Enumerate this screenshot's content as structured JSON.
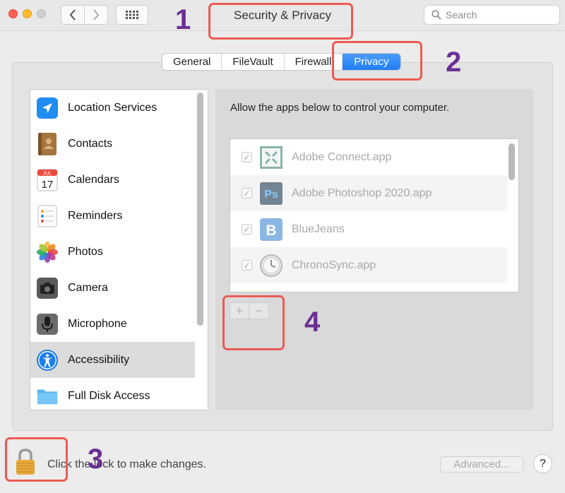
{
  "window": {
    "title": "Security & Privacy"
  },
  "search": {
    "placeholder": "Search"
  },
  "tabs": [
    {
      "label": "General",
      "active": false
    },
    {
      "label": "FileVault",
      "active": false
    },
    {
      "label": "Firewall",
      "active": false
    },
    {
      "label": "Privacy",
      "active": true
    }
  ],
  "sidebar": {
    "items": [
      {
        "label": "Location Services",
        "icon": "location-arrow-icon",
        "selected": false
      },
      {
        "label": "Contacts",
        "icon": "contacts-book-icon",
        "selected": false
      },
      {
        "label": "Calendars",
        "icon": "calendar-icon",
        "selected": false,
        "icon_text_month": "JUL",
        "icon_text_day": "17"
      },
      {
        "label": "Reminders",
        "icon": "reminders-list-icon",
        "selected": false
      },
      {
        "label": "Photos",
        "icon": "photos-flower-icon",
        "selected": false
      },
      {
        "label": "Camera",
        "icon": "camera-icon",
        "selected": false
      },
      {
        "label": "Microphone",
        "icon": "microphone-icon",
        "selected": false
      },
      {
        "label": "Accessibility",
        "icon": "accessibility-icon",
        "selected": true
      },
      {
        "label": "Full Disk Access",
        "icon": "folder-icon",
        "selected": false
      }
    ]
  },
  "main": {
    "description": "Allow the apps below to control your computer.",
    "apps": [
      {
        "name": "Adobe Connect.app",
        "checked": true,
        "icon": "adobe-connect-icon"
      },
      {
        "name": "Adobe Photoshop 2020.app",
        "checked": true,
        "icon": "photoshop-icon",
        "icon_text": "Ps"
      },
      {
        "name": "BlueJeans",
        "checked": true,
        "icon": "bluejeans-icon",
        "icon_text": "B"
      },
      {
        "name": "ChronoSync.app",
        "checked": true,
        "icon": "chronosync-clock-icon"
      }
    ],
    "add_label": "+",
    "remove_label": "−",
    "check_mark": "✓"
  },
  "footer": {
    "lock_text": "Click the lock to make changes.",
    "advanced_label": "Advanced...",
    "help_label": "?"
  },
  "annotations": [
    "1",
    "2",
    "3",
    "4"
  ],
  "colors": {
    "accent": "#1f7ef5",
    "annotation_box": "#ec5b53",
    "annotation_number": "#6a2f93"
  }
}
